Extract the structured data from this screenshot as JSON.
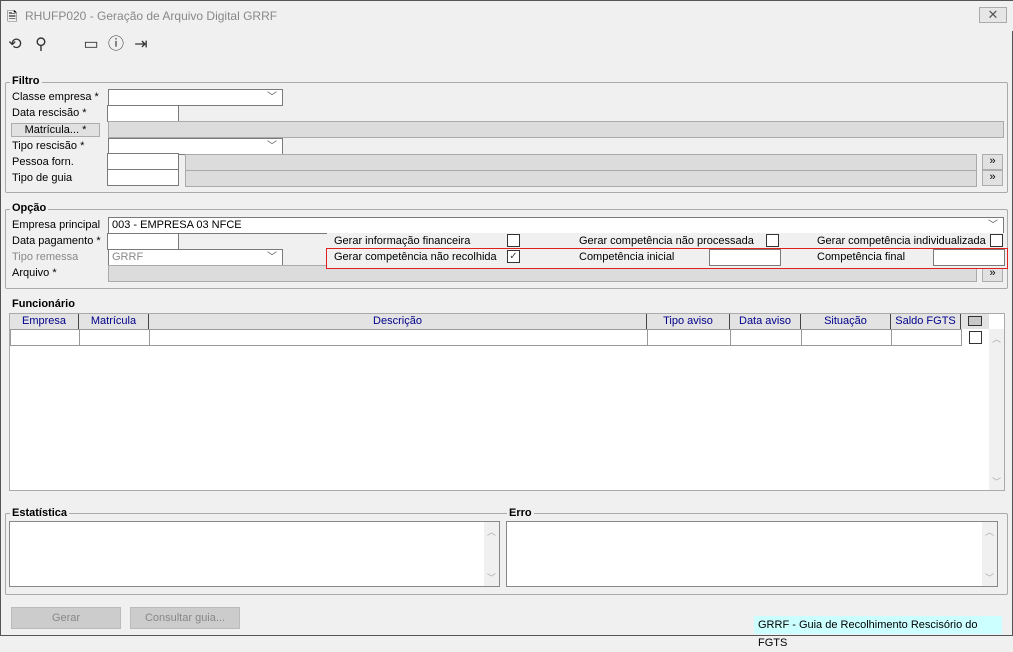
{
  "window": {
    "title": "RHUFP020 - Geração de Arquivo Digital GRRF",
    "close": "✕"
  },
  "toolbar": {
    "icons": [
      "undo-icon",
      "search-icon",
      "calendar-icon",
      "help-icon",
      "exit-icon"
    ]
  },
  "filtro": {
    "legend": "Filtro",
    "classe_empresa": "Classe empresa *",
    "data_rescisao": "Data rescisão *",
    "matricula_button": "Matrícula... *",
    "tipo_rescisao": "Tipo rescisão *",
    "pessoa_forn": "Pessoa forn.",
    "tipo_guia": "Tipo de guia",
    "more": "»"
  },
  "opcao": {
    "legend": "Opção",
    "empresa_principal": "Empresa principal",
    "empresa_principal_value": "003 - EMPRESA 03 NFCE",
    "data_pagamento": "Data pagamento *",
    "tipo_remessa": "Tipo remessa",
    "tipo_remessa_value": "GRRF",
    "arquivo": "Arquivo *",
    "more": "»",
    "gerar_info_financeira": "Gerar informação financeira",
    "gerar_info_financeira_checked": false,
    "gerar_comp_nao_processada": "Gerar competência não processada",
    "gerar_comp_nao_processada_checked": false,
    "gerar_comp_individualizada": "Gerar competência individualizada",
    "gerar_comp_individualizada_checked": false,
    "gerar_comp_nao_recolhida": "Gerar competência não recolhida",
    "gerar_comp_nao_recolhida_checked": true,
    "competencia_inicial": "Competência inicial",
    "competencia_final": "Competência final",
    "check": "✓"
  },
  "funcionario": {
    "label": "Funcionário",
    "columns": [
      "Empresa",
      "Matrícula",
      "Descrição",
      "Tipo aviso",
      "Data aviso",
      "Situação",
      "Saldo FGTS"
    ]
  },
  "estatistica": {
    "legend": "Estatística"
  },
  "erro": {
    "legend": "Erro"
  },
  "buttons": {
    "gerar": "Gerar",
    "consultar_guia": "Consultar guia..."
  },
  "status": {
    "text": "GRRF - Guia de Recolhimento Rescisório do FGTS"
  },
  "colors": {
    "highlight": "#e02020",
    "status_bg": "#ccffff",
    "header_text": "#00008b"
  }
}
